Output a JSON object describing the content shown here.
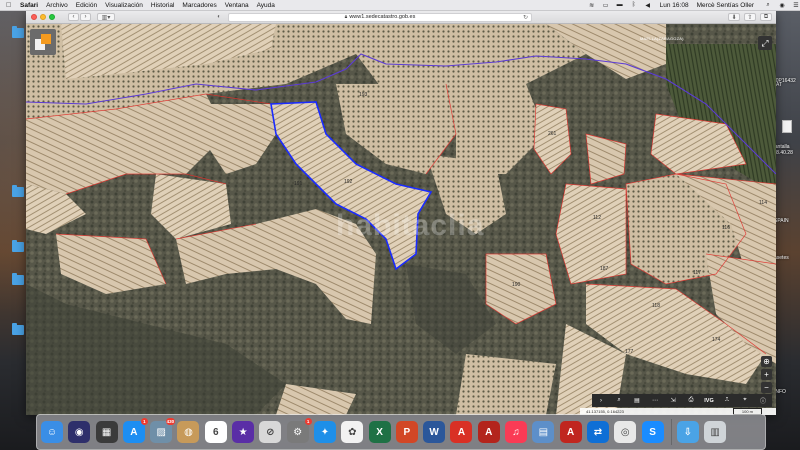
{
  "menubar": {
    "app_name": "Safari",
    "items": [
      "Archivo",
      "Edición",
      "Visualización",
      "Historial",
      "Marcadores",
      "Ventana",
      "Ayuda"
    ],
    "clock": "Lun 16:08",
    "user": "Mercè Sentías Oller"
  },
  "browser": {
    "url": "www1.sedecatastro.gob.es"
  },
  "map": {
    "region_label": "MAELLA(ZARAGOZA)",
    "watermark": "habitaclia",
    "parcel_numbers": [
      {
        "id": "p1",
        "label": "261"
      },
      {
        "id": "p2",
        "label": "193"
      },
      {
        "id": "p3",
        "label": "192"
      },
      {
        "id": "p4",
        "label": "191"
      },
      {
        "id": "p5",
        "label": "112"
      },
      {
        "id": "p6",
        "label": "117"
      },
      {
        "id": "p7",
        "label": "116"
      },
      {
        "id": "p8",
        "label": "114"
      },
      {
        "id": "p9",
        "label": "118"
      },
      {
        "id": "p10",
        "label": "187"
      },
      {
        "id": "p11",
        "label": "174"
      },
      {
        "id": "p12",
        "label": "177"
      },
      {
        "id": "p13",
        "label": "190"
      }
    ],
    "toolbar": [
      "›",
      "⌕",
      "▤",
      "⋯",
      "⇲",
      "⎙",
      "IVG",
      "⎍",
      "⌖",
      "ⓘ"
    ],
    "zoom_in": "+",
    "zoom_out": "−",
    "locate": "⊕",
    "coords": "41.137155, 0.164223",
    "scale": "100 m"
  },
  "desktop_labels": {
    "top_right": "00P16432",
    "mid_right_1": "AT",
    "pantalla": "pantalla",
    "pantalla_time": "a 8.40.28",
    "spain": "SPAIN",
    "casetes": "asetes",
    "info": "INFO"
  },
  "dock": {
    "items": [
      {
        "name": "finder",
        "color": "#3a8ee6",
        "glyph": "☺"
      },
      {
        "name": "siri",
        "color": "#2e2f6b",
        "glyph": "◉"
      },
      {
        "name": "mission-control",
        "color": "#3b3b3b",
        "glyph": "▦"
      },
      {
        "name": "app-store",
        "color": "#1d8ef2",
        "glyph": "A",
        "badge": "1"
      },
      {
        "name": "preview",
        "color": "#6f8fa8",
        "glyph": "▨",
        "badge": "430"
      },
      {
        "name": "contacts",
        "color": "#c79a5a",
        "glyph": "◍"
      },
      {
        "name": "calendar",
        "color": "#ffffff",
        "glyph": "6"
      },
      {
        "name": "imovie",
        "color": "#5a2ea6",
        "glyph": "★"
      },
      {
        "name": "no-entry",
        "color": "#d8d8d8",
        "glyph": "⊘"
      },
      {
        "name": "system-preferences",
        "color": "#7a7a7a",
        "glyph": "⚙",
        "badge": "1"
      },
      {
        "name": "safari",
        "color": "#1e8fe8",
        "glyph": "✦"
      },
      {
        "name": "photos",
        "color": "#f2f2f2",
        "glyph": "✿"
      },
      {
        "name": "excel",
        "color": "#1e7145",
        "glyph": "X"
      },
      {
        "name": "powerpoint",
        "color": "#d24726",
        "glyph": "P"
      },
      {
        "name": "word",
        "color": "#2b579a",
        "glyph": "W"
      },
      {
        "name": "acrobat-1",
        "color": "#d93025",
        "glyph": "A"
      },
      {
        "name": "acrobat-2",
        "color": "#b3241c",
        "glyph": "A"
      },
      {
        "name": "music",
        "color": "#fa3b55",
        "glyph": "♫"
      },
      {
        "name": "preview-2",
        "color": "#5d8fc9",
        "glyph": "▤"
      },
      {
        "name": "acrobat-3",
        "color": "#c0261f",
        "glyph": "A"
      },
      {
        "name": "teamviewer",
        "color": "#0e6fd6",
        "glyph": "⇄"
      },
      {
        "name": "chrome",
        "color": "#e8e8e8",
        "glyph": "◎"
      },
      {
        "name": "shazam",
        "color": "#1a8cff",
        "glyph": "S"
      },
      {
        "name": "downloads-folder",
        "color": "#4aa3e6",
        "glyph": "⇩"
      },
      {
        "name": "trash",
        "color": "#cfd4d8",
        "glyph": "▥"
      }
    ]
  }
}
